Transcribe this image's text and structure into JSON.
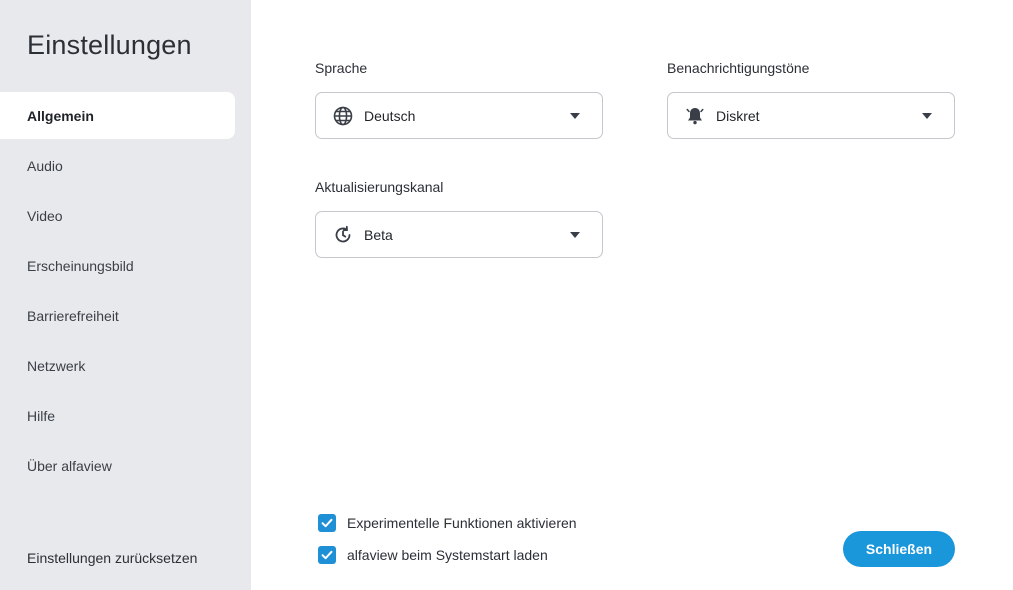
{
  "sidebar": {
    "title": "Einstellungen",
    "items": [
      {
        "label": "Allgemein",
        "active": true
      },
      {
        "label": "Audio"
      },
      {
        "label": "Video"
      },
      {
        "label": "Erscheinungsbild"
      },
      {
        "label": "Barrierefreiheit"
      },
      {
        "label": "Netzwerk"
      },
      {
        "label": "Hilfe"
      },
      {
        "label": "Über alfaview"
      }
    ],
    "reset_label": "Einstellungen zurücksetzen"
  },
  "fields": {
    "language": {
      "label": "Sprache",
      "value": "Deutsch",
      "icon": "globe-icon"
    },
    "notification_sounds": {
      "label": "Benachrichtigungstöne",
      "value": "Diskret",
      "icon": "bell-icon"
    },
    "update_channel": {
      "label": "Aktualisierungskanal",
      "value": "Beta",
      "icon": "update-icon"
    }
  },
  "checkboxes": [
    {
      "label": "Experimentelle Funktionen aktivieren",
      "checked": true
    },
    {
      "label": "alfaview beim Systemstart laden",
      "checked": true
    }
  ],
  "close_button": {
    "label": "Schließen"
  },
  "colors": {
    "accent": "#1a96db",
    "sidebar_bg": "#e8e9ec"
  }
}
